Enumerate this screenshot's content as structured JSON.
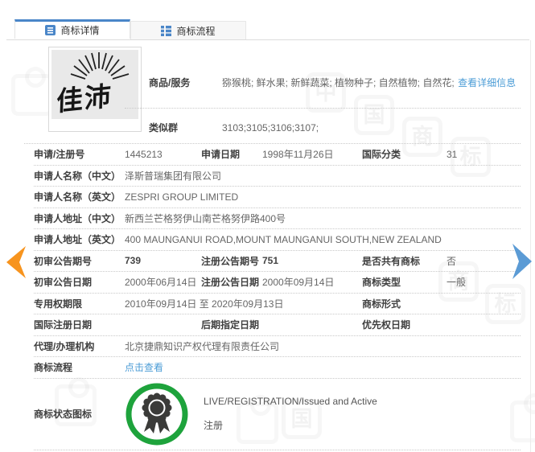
{
  "tabs": {
    "detail": {
      "label": "商标详情"
    },
    "process": {
      "label": "商标流程"
    }
  },
  "trademark": {
    "logo_text": "佳沛"
  },
  "top": {
    "goods_label": "商品/服务",
    "goods_value": "猕猴桃; 鲜水果; 新鲜蔬菜; 植物种子; 自然植物; 自然花;",
    "goods_link": "查看详细信息",
    "similar_label": "类似群",
    "similar_value": "3103;3105;3106;3107;"
  },
  "fields": {
    "reg_no_label": "申请/注册号",
    "reg_no": "1445213",
    "app_date_label": "申请日期",
    "app_date": "1998年11月26日",
    "intl_class_label": "国际分类",
    "intl_class": "31",
    "applicant_cn_label": "申请人名称（中文）",
    "applicant_cn": "泽斯普瑞集团有限公司",
    "applicant_en_label": "申请人名称（英文）",
    "applicant_en": "ZESPRI GROUP LIMITED",
    "addr_cn_label": "申请人地址（中文）",
    "addr_cn": "新西兰芒格努伊山南芒格努伊路400号",
    "addr_en_label": "申请人地址（英文）",
    "addr_en": "400 MAUNGANUI ROAD,MOUNT MAUNGANUI SOUTH,NEW ZEALAND",
    "first_pub_no_label": "初审公告期号",
    "first_pub_no": "739",
    "reg_pub_no_label": "注册公告期号",
    "reg_pub_no": "751",
    "shared_label": "是否共有商标",
    "shared": "否",
    "first_pub_date_label": "初审公告日期",
    "first_pub_date": "2000年06月14日",
    "reg_pub_date_label": "注册公告日期",
    "reg_pub_date": "2000年09月14日",
    "tm_type_label": "商标类型",
    "tm_type": "一般",
    "right_period_label": "专用权期限",
    "right_period": "2010年09月14日 至 2020年09月13日",
    "tm_form_label": "商标形式",
    "tm_form": "",
    "intl_reg_date_label": "国际注册日期",
    "intl_reg_date": "",
    "later_desig_label": "后期指定日期",
    "later_desig": "",
    "priority_label": "优先权日期",
    "priority": "",
    "agency_label": "代理/办理机构",
    "agency": "北京捷鼎知识产权代理有限责任公司",
    "process_label": "商标流程",
    "process_link": "点击查看"
  },
  "status": {
    "label": "商标状态图标",
    "line1": "LIVE/REGISTRATION/Issued and Active",
    "line2": "注册"
  },
  "watermark": {
    "g1": "中",
    "g2": "国",
    "g3": "商",
    "g4": "标",
    "g5": "商",
    "g6": "标",
    "g7": "国"
  },
  "colors": {
    "tab_accent_blue": "#4a86c8",
    "link_blue": "#4b9cd6",
    "arrow_orange": "#F7941E",
    "arrow_blue": "#5B9BD5",
    "badge_green": "#1ea33c"
  }
}
